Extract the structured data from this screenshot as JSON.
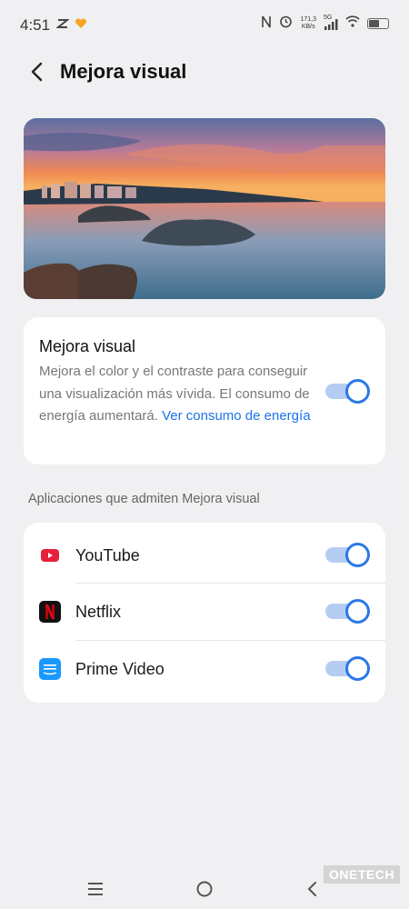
{
  "status_bar": {
    "time": "4:51",
    "net_speed_value": "171,3",
    "net_speed_unit": "KB/s",
    "network": "5G",
    "icons": [
      "notification-icon",
      "heart-icon",
      "nfc-icon",
      "alarm-icon",
      "signal-icon",
      "wifi-icon",
      "battery-icon"
    ],
    "battery_level": 0.6
  },
  "header": {
    "title": "Mejora visual",
    "back_icon": "back-arrow-icon"
  },
  "enhance_card": {
    "title": "Mejora visual",
    "description": "Mejora el color y el contraste para conseguir una visualización más vívida. El consumo de energía aumentará. ",
    "link": "Ver consumo de energía",
    "enabled": true
  },
  "apps_section": {
    "label": "Aplicaciones que admiten Mejora visual",
    "items": [
      {
        "label": "YouTube",
        "icon": "youtube-icon",
        "enabled": true
      },
      {
        "label": "Netflix",
        "icon": "netflix-icon",
        "enabled": true
      },
      {
        "label": "Prime Video",
        "icon": "prime-video-icon",
        "enabled": true
      }
    ]
  },
  "nav": {
    "menu_icon": "menu-icon",
    "home_icon": "home-icon",
    "back_icon": "back-icon"
  },
  "watermark": "ONETECH",
  "colors": {
    "accent": "#2a78e8",
    "link": "#1a73e8",
    "background": "#f0f0f2",
    "card": "#ffffff"
  }
}
